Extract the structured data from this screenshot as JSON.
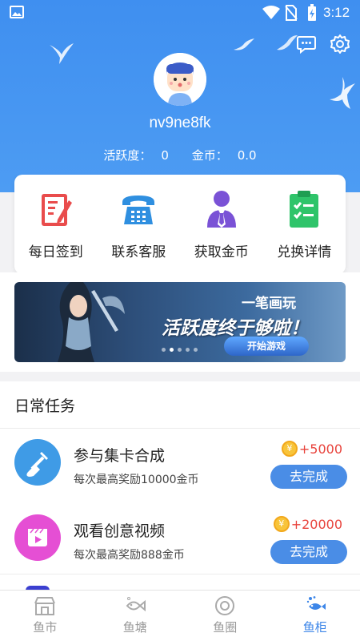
{
  "status_bar": {
    "time": "3:12"
  },
  "profile": {
    "username": "nv9ne8fk",
    "activity_label": "活跃度：",
    "activity_value": "0",
    "coins_label": "金币：",
    "coins_value": "0.0"
  },
  "quick_actions": [
    {
      "label": "每日签到",
      "icon": "checkin-clipboard-icon"
    },
    {
      "label": "联系客服",
      "icon": "telephone-icon"
    },
    {
      "label": "获取金币",
      "icon": "person-tie-icon"
    },
    {
      "label": "兑换详情",
      "icon": "checklist-icon"
    }
  ],
  "banner": {
    "subtitle": "一笔画玩",
    "headline": "活跃度终于够啦！",
    "button": "开始游戏",
    "slides": 5,
    "active_slide": 1
  },
  "daily_tasks": {
    "heading": "日常任务",
    "items": [
      {
        "title": "参与集卡合成",
        "description": "每次最高奖励10000金币",
        "reward": "+5000",
        "button": "去完成",
        "icon": "shovel-icon",
        "color": "#3f9be6"
      },
      {
        "title": "观看创意视频",
        "description": "每次最高奖励888金币",
        "reward": "+20000",
        "button": "去完成",
        "icon": "video-play-icon",
        "color": "#e54fd4"
      }
    ]
  },
  "tabbar": [
    {
      "label": "鱼市",
      "icon": "store-icon",
      "active": false
    },
    {
      "label": "鱼塘",
      "icon": "fish-icon",
      "active": false
    },
    {
      "label": "鱼圈",
      "icon": "circle-target-icon",
      "active": false
    },
    {
      "label": "鱼柜",
      "icon": "fish-cabinet-icon",
      "active": true
    }
  ],
  "colors": {
    "header_blue": "#4a97f2",
    "accent_blue": "#4a8de6",
    "reward_red": "#e8433c",
    "coin_gold": "#f8c43a"
  }
}
